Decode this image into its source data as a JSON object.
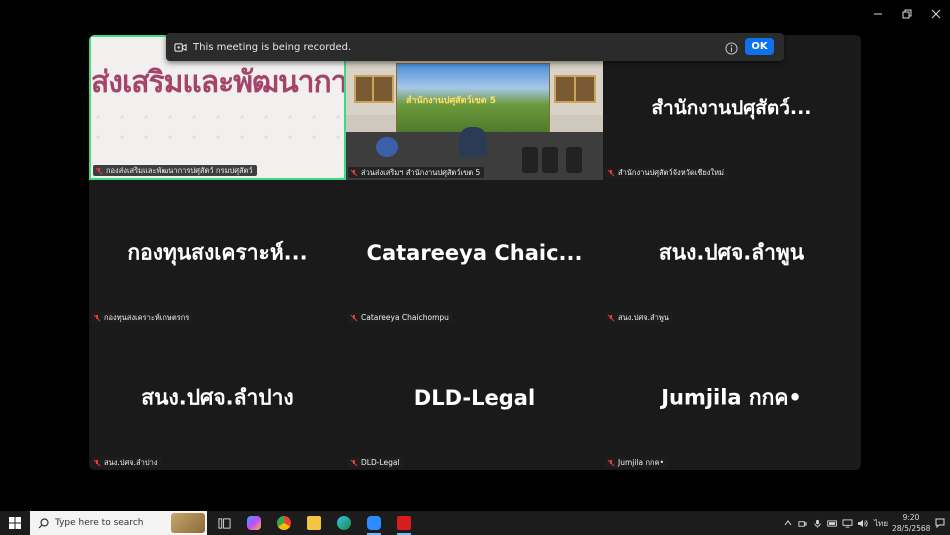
{
  "window": {
    "controls": [
      "minimize-icon",
      "restore-icon",
      "close-icon"
    ]
  },
  "recording_banner": {
    "text": "This meeting is being recorded.",
    "ok_label": "OK",
    "ok_color": "#0e72ed"
  },
  "gallery": {
    "tiles": [
      {
        "big": "",
        "label": "กองส่งเสริมและพัฒนาการปศุสัตว์ กรมปศุสัตว์",
        "video_text": "ส่งเสริมและพัฒนากา",
        "type": "video",
        "active_speaker": true
      },
      {
        "big": "",
        "label": "ส่วนส่งเสริมฯ สำนักงานปศุสัตว์เขต 5",
        "video_text": "สำนักงานปศุสัตว์เขต 5",
        "type": "video"
      },
      {
        "big": "สำนักงานปศุสัตว์...",
        "label": "สำนักงานปศุสัตว์จังหวัดเชียงใหม่",
        "type": "name"
      },
      {
        "big": "กองทุนสงเคราะห์...",
        "label": "กองทุนสงเคราะห์เกษตรกร",
        "type": "name"
      },
      {
        "big": "Catareeya Chaic...",
        "label": "Catareeya Chaichompu",
        "type": "name"
      },
      {
        "big": "สนง.ปศจ.ลำพูน",
        "label": "สนง.ปศจ.ลำพูน",
        "type": "name"
      },
      {
        "big": "สนง.ปศจ.ลำปาง",
        "label": "สนง.ปศจ.ลำปาง",
        "type": "name"
      },
      {
        "big": "DLD-Legal",
        "label": "DLD-Legal",
        "type": "name"
      },
      {
        "big": "Jumjila กกค•",
        "label": "Jumjila กกค•",
        "type": "name"
      }
    ],
    "active_border_color": "#3ddc84"
  },
  "taskbar": {
    "search_placeholder": "Type here to search",
    "apps": [
      "task-view-icon",
      "copilot-icon",
      "chrome-icon",
      "file-explorer-icon",
      "edge-icon",
      "zoom-icon",
      "acrobat-icon"
    ],
    "tray_icons": [
      "chevron-up-icon",
      "meet-now-icon",
      "microphone-icon",
      "battery-icon",
      "network-icon",
      "volume-icon"
    ],
    "language": "ไทย",
    "time": "9:20",
    "date": "28/5/2568"
  }
}
